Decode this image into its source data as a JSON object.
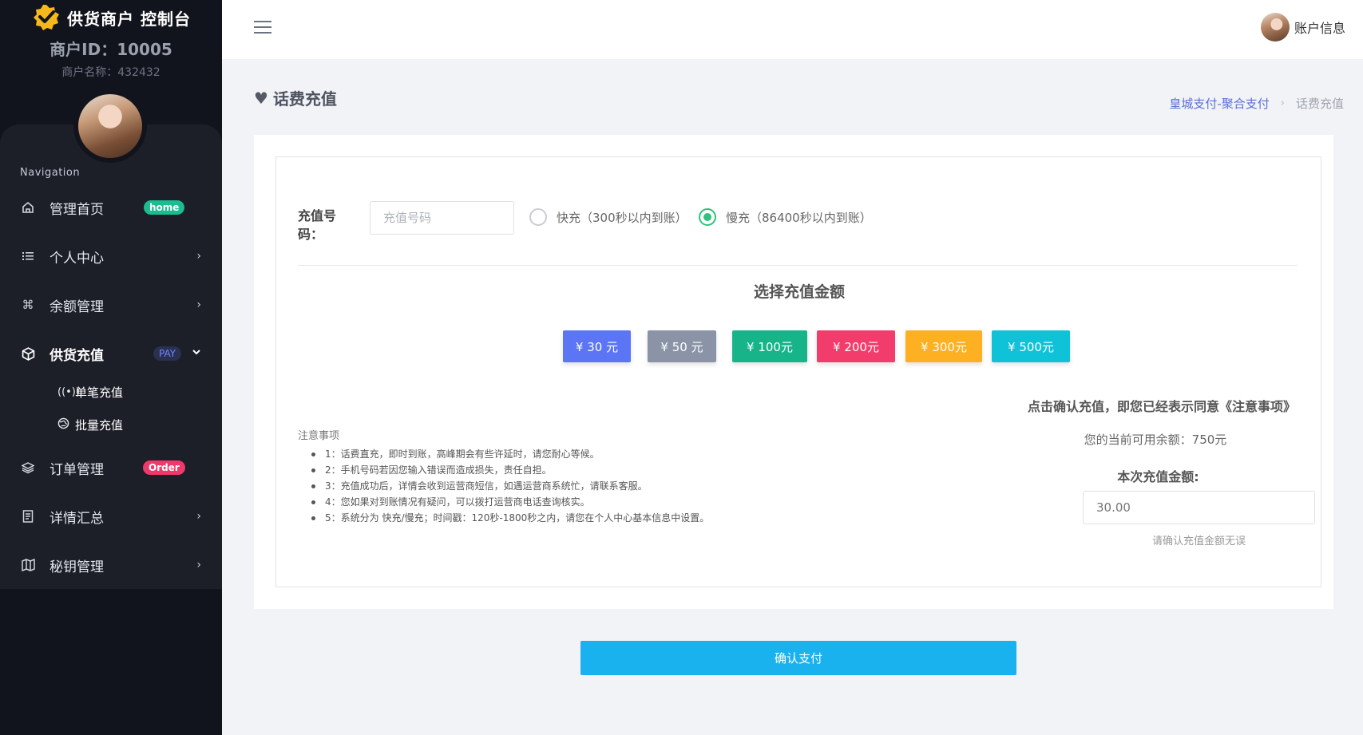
{
  "brand": {
    "title": "供货商户 控制台",
    "merchant_id": "商户ID：10005",
    "merchant_name": "商户名称：432432"
  },
  "sidebar": {
    "heading": "Navigation",
    "items": [
      {
        "label": "管理首页",
        "icon": "home-icon",
        "badge": "home"
      },
      {
        "label": "个人中心",
        "icon": "list-icon"
      },
      {
        "label": "余额管理",
        "icon": "command-icon"
      },
      {
        "label": "供货充值",
        "icon": "box-icon",
        "badge": "PAY",
        "expanded": true
      },
      {
        "label": "订单管理",
        "icon": "layers-icon",
        "badge": "Order"
      },
      {
        "label": "详情汇总",
        "icon": "document-icon"
      },
      {
        "label": "秘钥管理",
        "icon": "map-icon"
      }
    ],
    "sub_items": [
      {
        "label": "单笔充值",
        "icon": "broadcast-icon"
      },
      {
        "label": "批量充值",
        "icon": "globe-icon"
      }
    ]
  },
  "topbar": {
    "user_label": "账户信息"
  },
  "page": {
    "title": "话费充值",
    "breadcrumb": {
      "parent": "皇城支付-聚合支付",
      "current": "话费充值"
    }
  },
  "form": {
    "phone_label": "充值号码：",
    "phone_placeholder": "充值号码",
    "phone_value": "",
    "options": [
      {
        "label": "快充（300秒以内到账）",
        "checked": false
      },
      {
        "label": "慢充（86400秒以内到账）",
        "checked": true
      }
    ],
    "amount_title": "选择充值金额",
    "amounts": [
      {
        "label": "¥ 30 元",
        "color": "#5b75f5"
      },
      {
        "label": "¥ 50 元",
        "color": "#8a94a6"
      },
      {
        "label": "¥ 100元",
        "color": "#18b489"
      },
      {
        "label": "¥ 200元",
        "color": "#f23c6c"
      },
      {
        "label": "¥ 300元",
        "color": "#fdb022"
      },
      {
        "label": "¥ 500元",
        "color": "#10c2d8"
      }
    ],
    "notes_title": "注意事项",
    "notes": [
      "1：话费直充，即时到账，高峰期会有些许延时，请您耐心等候。",
      "2：手机号码若因您输入错误而造成损失，责任自担。",
      "3：充值成功后，详情会收到运营商短信，如遇运营商系统忙，请联系客服。",
      "4：您如果对到账情况有疑问，可以拨打运营商电话查询核实。",
      "5：系统分为 快充/慢充；时间戳：120秒-1800秒之内，请您在个人中心基本信息中设置。"
    ],
    "agree_text": "点击确认充值，即您已经表示同意《注意事项》",
    "balance_text": "您的当前可用余额：750元",
    "this_amount_label": "本次充值金额:",
    "amount_value": "30.00",
    "amount_hint": "请确认充值金额无误",
    "confirm_label": "确认支付"
  }
}
